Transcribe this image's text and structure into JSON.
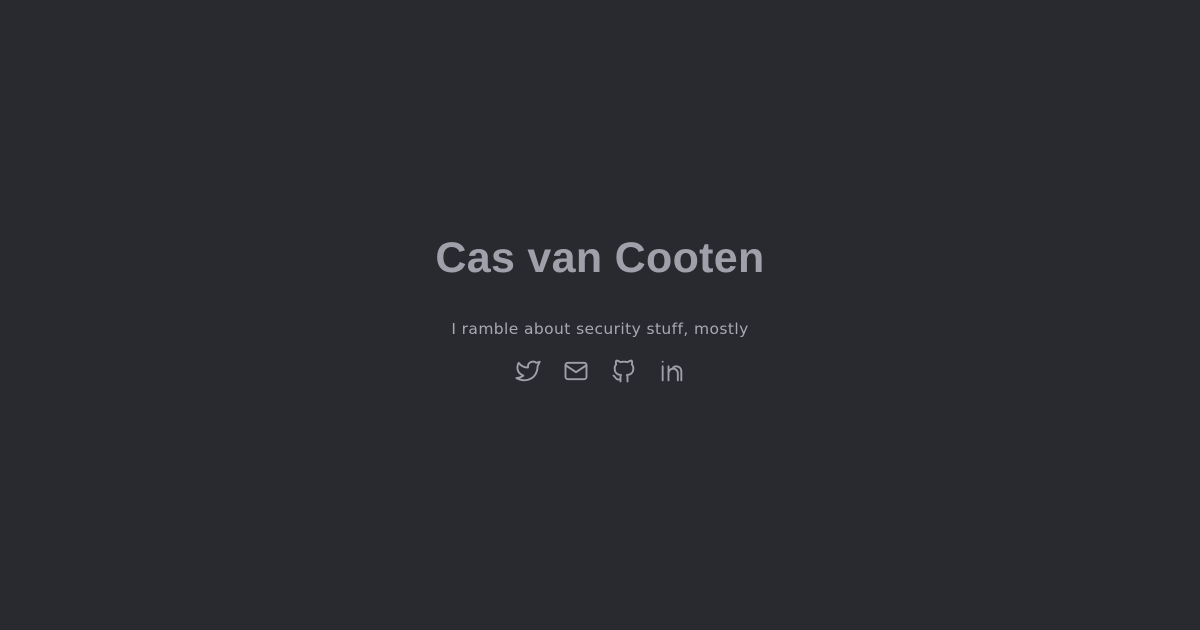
{
  "header": {
    "title": "Cas van Cooten",
    "tagline": "I ramble about security stuff, mostly"
  },
  "social_links": [
    {
      "icon": "twitter-icon"
    },
    {
      "icon": "mail-icon"
    },
    {
      "icon": "github-icon"
    },
    {
      "icon": "linkedin-icon"
    }
  ],
  "colors": {
    "background": "#292a2f",
    "title": "#a0a0ab",
    "tagline": "#a8a8b2",
    "icons": "#a0a0ab"
  }
}
